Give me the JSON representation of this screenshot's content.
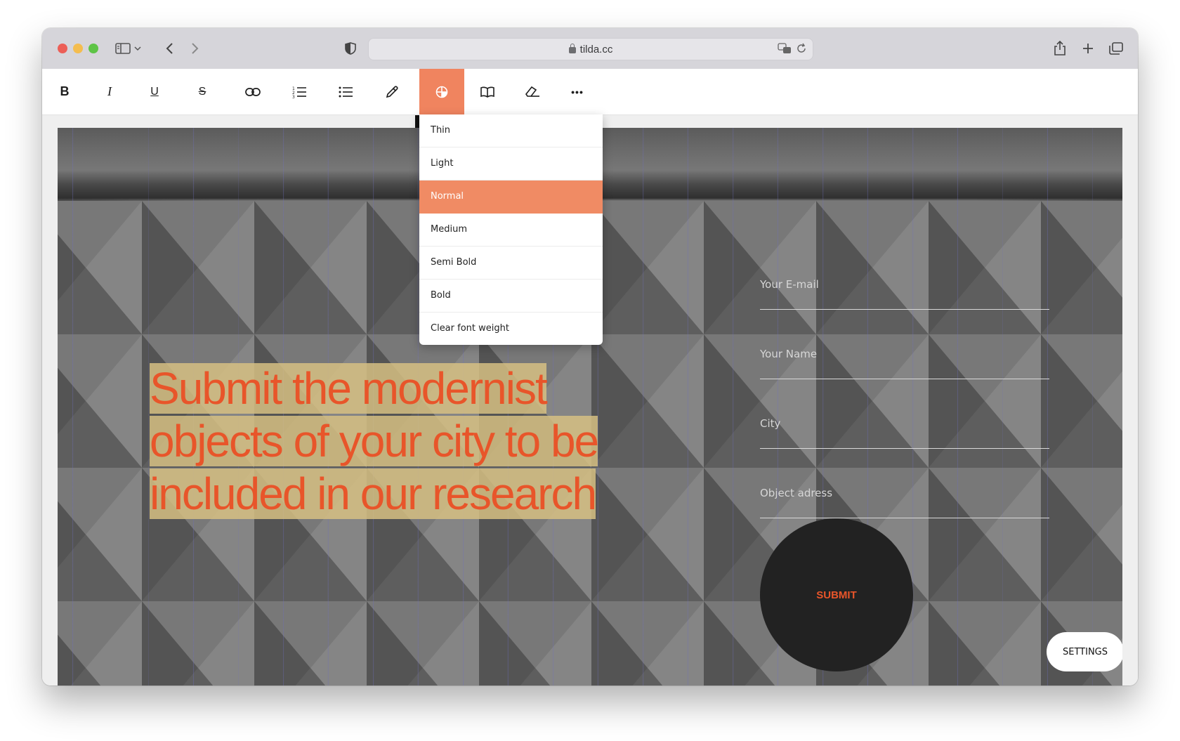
{
  "browser": {
    "url": "tilda.cc",
    "icons": [
      "sidebar-icon",
      "chevron-down-icon",
      "back-icon",
      "forward-icon",
      "shield-icon",
      "translate-icon",
      "reload-icon",
      "share-icon",
      "new-tab-icon",
      "tabs-overview-icon"
    ]
  },
  "toolbar": {
    "buttons": [
      {
        "name": "bold",
        "glyph": "B"
      },
      {
        "name": "italic",
        "glyph": "I"
      },
      {
        "name": "underline",
        "glyph": "U"
      },
      {
        "name": "strikethrough",
        "glyph": "S"
      },
      {
        "name": "link"
      },
      {
        "name": "ordered-list"
      },
      {
        "name": "unordered-list"
      },
      {
        "name": "color-picker"
      },
      {
        "name": "font-weight",
        "active": true
      },
      {
        "name": "typography"
      },
      {
        "name": "clear-format"
      },
      {
        "name": "more",
        "glyph": "•••"
      }
    ]
  },
  "font_weight_menu": {
    "items": [
      "Thin",
      "Light",
      "Normal",
      "Medium",
      "Semi Bold",
      "Bold",
      "Clear font weight"
    ],
    "selected": "Normal"
  },
  "headline": {
    "lines": [
      "Submit the modernist",
      "objects of your city to be",
      "included in our research"
    ]
  },
  "form": {
    "email_placeholder": "Your E-mail",
    "name_placeholder": "Your Name",
    "city_placeholder": "City",
    "address_placeholder": "Object adress",
    "submit_label": "SUBMIT"
  },
  "settings_label": "SETTINGS",
  "colors": {
    "accent": "#f0845f",
    "headline_text": "#e8552a",
    "highlight": "#d6c082"
  }
}
